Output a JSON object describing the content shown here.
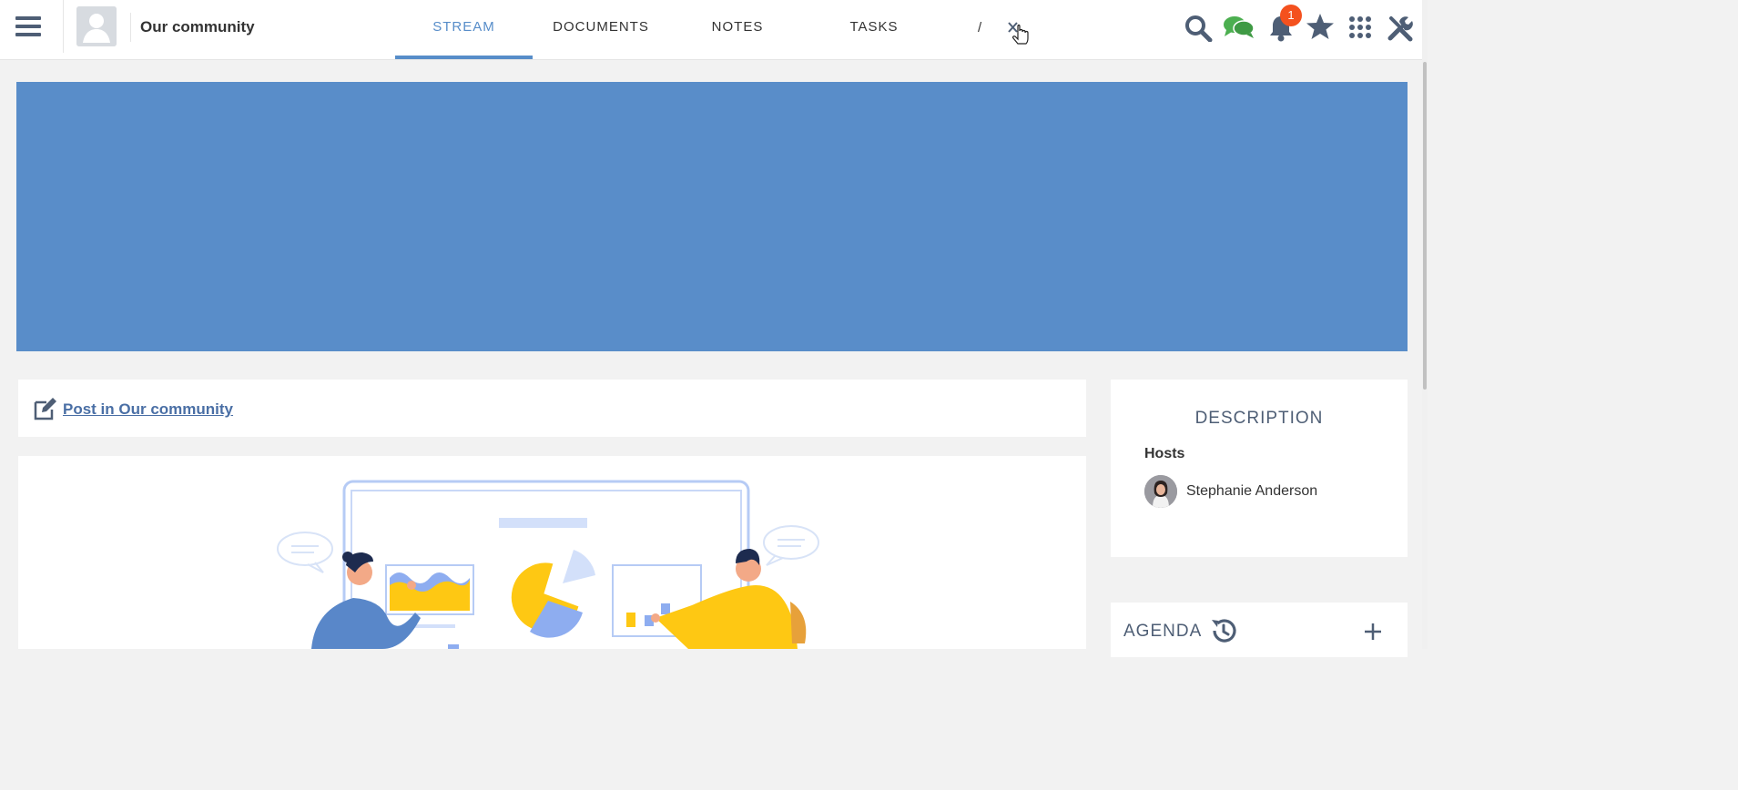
{
  "topbar": {
    "space_name": "Our community",
    "tabs": [
      {
        "label": "STREAM",
        "active": true
      },
      {
        "label": "DOCUMENTS",
        "active": false
      },
      {
        "label": "NOTES",
        "active": false
      },
      {
        "label": "TASKS",
        "active": false
      }
    ],
    "partial_tab_glyph": "/",
    "icons": [
      "hamburger-icon",
      "space-avatar-icon",
      "search-icon",
      "chat-icon",
      "bell-icon",
      "star-icon",
      "apps-grid-icon",
      "tools-icon"
    ],
    "notification_count": "1"
  },
  "composer": {
    "label": " Post in Our community",
    "icon": "edit-icon"
  },
  "description": {
    "title": "DESCRIPTION",
    "hosts_label": "Hosts",
    "host_name": "Stephanie Anderson"
  },
  "agenda": {
    "title": "AGENDA",
    "icons": [
      "history-icon",
      "plus-icon"
    ]
  },
  "colors": {
    "accent": "#578dc9",
    "banner": "#598dc9",
    "badge": "#f4511e",
    "chat": "#4caf50",
    "icon": "#4e5e75",
    "illustration_yellow": "#fec813",
    "illustration_blue": "#8eadf0"
  }
}
